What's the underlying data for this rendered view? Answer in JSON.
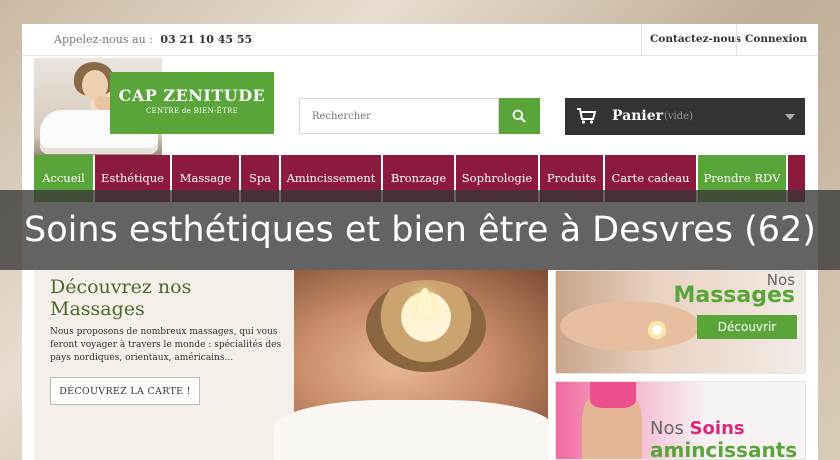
{
  "topbar": {
    "phone_label": "Appelez-nous au :",
    "phone_number": "03 21 10 45 55",
    "contact_label": "Contactez-nous",
    "login_label": "Connexion"
  },
  "logo": {
    "title": "CAP ZENITUDE",
    "subtitle": "CENTRE de BIEN-ÊTRE"
  },
  "search": {
    "placeholder": "Rechercher",
    "icon": "search-icon"
  },
  "cart": {
    "label": "Panier",
    "status": "(vide)",
    "icon": "cart-icon"
  },
  "nav": {
    "items": [
      {
        "label": "Accueil"
      },
      {
        "label": "Esthétique"
      },
      {
        "label": "Massage"
      },
      {
        "label": "Spa"
      },
      {
        "label": "Amincissement"
      },
      {
        "label": "Bronzage"
      },
      {
        "label": "Sophrologie"
      },
      {
        "label": "Produits"
      },
      {
        "label": "Carte cadeau"
      },
      {
        "label": "Prendre RDV"
      }
    ]
  },
  "banner": {
    "title": "Soins esthétiques et bien être à Desvres (62)"
  },
  "hero": {
    "heading": "Découvrez nos\nMassages",
    "text": "Nous proposons de nombreux massages, qui vous feront voyager à travers le monde : spécialités des pays nordiques, orientaux, américains...",
    "button_label": "DÉCOUVREZ LA CARTE !"
  },
  "promo_massages": {
    "small": "Nos",
    "big": "Massages",
    "button_label": "Découvrir"
  },
  "promo_amincissants": {
    "pre": "Nos ",
    "highlight": "Soins",
    "line2": "amincissants"
  },
  "colors": {
    "brand_green": "#5aa539",
    "nav_bordeaux": "#8b1a3d",
    "cart_dark": "#333333"
  }
}
